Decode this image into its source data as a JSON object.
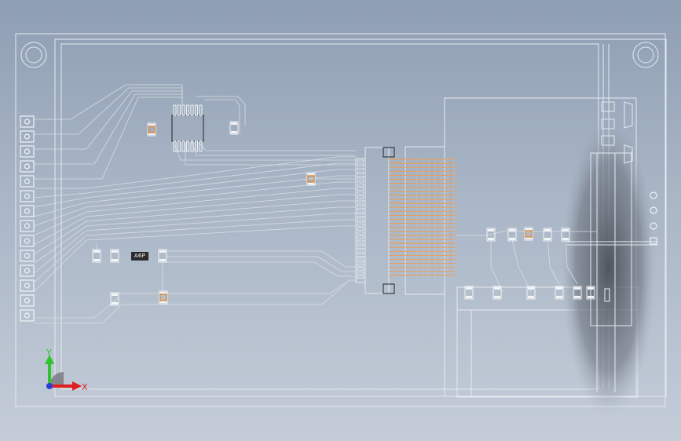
{
  "viewport": {
    "background_top": "#8e9eb3",
    "background_bottom": "#c4ccd8"
  },
  "board": {
    "outline_color": "#e6eaf0",
    "trace_color": "#d9dde4",
    "pad_color": "#f2f4f8",
    "accent_pad_color": "#e08a3a",
    "connector_fill_color": "#e6a060",
    "ic_labels": [
      "A6P"
    ]
  },
  "triad": {
    "x_label": "X",
    "y_label": "Y",
    "x_color": "#e02020",
    "y_color": "#2ec42e",
    "z_color": "#2a3cd8"
  }
}
